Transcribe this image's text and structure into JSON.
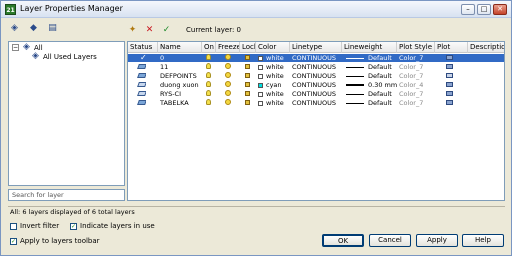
{
  "window": {
    "title": "Layer Properties Manager",
    "app_icon": "autocad-icon",
    "min": "–",
    "max": "□",
    "close": "✕"
  },
  "toolbar": {
    "current_layer_label": "Current layer: 0"
  },
  "tree": {
    "root": "All",
    "child": "All Used Layers"
  },
  "search": {
    "placeholder": "Search for layer"
  },
  "grid": {
    "columns": [
      "Status",
      "Name",
      "On",
      "Freeze",
      "Lock",
      "Color",
      "Linetype",
      "Lineweight",
      "Plot Style",
      "Plot",
      "Descriptio"
    ],
    "rows": [
      {
        "name": "0",
        "color_name": "white",
        "color_hex": "#ffffff",
        "linetype": "CONTINUOUS",
        "lineweight": "Default",
        "plot_style": "Color_7",
        "selected": true,
        "current": true
      },
      {
        "name": "11",
        "color_name": "white",
        "color_hex": "#ffffff",
        "linetype": "CONTINUOUS",
        "lineweight": "Default",
        "plot_style": "Color_7",
        "selected": false,
        "current": false
      },
      {
        "name": "DEFPOINTS",
        "color_name": "white",
        "color_hex": "#ffffff",
        "linetype": "CONTINUOUS",
        "lineweight": "Default",
        "plot_style": "Color_7",
        "selected": false,
        "current": false
      },
      {
        "name": "duong xuon",
        "color_name": "cyan",
        "color_hex": "#00ffff",
        "linetype": "CONTINUOUS",
        "lineweight": "0.30 mm",
        "plot_style": "Color_4",
        "selected": false,
        "current": false
      },
      {
        "name": "RYS-CI",
        "color_name": "white",
        "color_hex": "#ffffff",
        "linetype": "CONTINUOUS",
        "lineweight": "Default",
        "plot_style": "Color_7",
        "selected": false,
        "current": false
      },
      {
        "name": "TABELKA",
        "color_name": "white",
        "color_hex": "#ffffff",
        "linetype": "CONTINUOUS",
        "lineweight": "Default",
        "plot_style": "Color_7",
        "selected": false,
        "current": false
      }
    ]
  },
  "status": {
    "text": "All: 6 layers displayed of 6 total layers"
  },
  "options": {
    "invert_filter": {
      "label": "Invert filter",
      "checked": false
    },
    "indicate_in_use": {
      "label": "Indicate layers in use",
      "checked": true
    },
    "apply_toolbar": {
      "label": "Apply to layers toolbar",
      "checked": true
    }
  },
  "buttons": {
    "ok": "OK",
    "cancel": "Cancel",
    "apply": "Apply",
    "help": "Help"
  }
}
